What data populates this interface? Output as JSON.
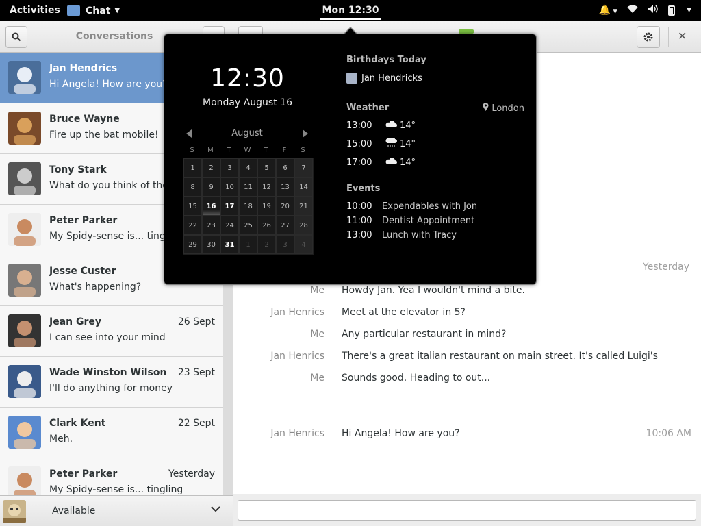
{
  "topbar": {
    "activities": "Activities",
    "app_name": "Chat",
    "clock": "Mon 12:30"
  },
  "sidebar": {
    "title": "Conversations",
    "conversations": [
      {
        "name": "Jan Hendrics",
        "message": "Hi Angela! How are you?",
        "date": "",
        "selected": true
      },
      {
        "name": "Bruce Wayne",
        "message": "Fire up the bat mobile!",
        "date": ""
      },
      {
        "name": "Tony Stark",
        "message": "What do you think of these",
        "date": ""
      },
      {
        "name": "Peter Parker",
        "message": "My Spidy-sense is... tingling",
        "date": ""
      },
      {
        "name": "Jesse Custer",
        "message": "What's happening?",
        "date": ""
      },
      {
        "name": "Jean Grey",
        "message": "I can see into your mind",
        "date": "26 Sept"
      },
      {
        "name": "Wade Winston Wilson",
        "message": "I'll do anything for money",
        "date": "23 Sept"
      },
      {
        "name": "Clark Kent",
        "message": "Meh.",
        "date": "22 Sept"
      },
      {
        "name": "Peter Parker",
        "message": "My Spidy-sense is... tingling",
        "date": "Yesterday"
      }
    ],
    "status": "Available"
  },
  "chat": {
    "day_label": "Yesterday",
    "messages": [
      {
        "who": "Me",
        "text": "Howdy Jan. Yea I wouldn't mind a bite."
      },
      {
        "who": "Jan Henrics",
        "text": "Meet at the elevator in 5?"
      },
      {
        "who": "Me",
        "text": "Any particular restaurant in mind?"
      },
      {
        "who": "Jan Henrics",
        "text": "There's a great italian restaurant on main street. It's called Luigi's"
      },
      {
        "who": "Me",
        "text": "Sounds good. Heading to out..."
      }
    ],
    "latest": {
      "who": "Jan Henrics",
      "text": "Hi Angela! How are you?",
      "time": "10:06 AM"
    },
    "entry_placeholder": ""
  },
  "calendar_popup": {
    "time": "12:30",
    "date": "Monday August 16",
    "month": "August",
    "weekdays": [
      "S",
      "M",
      "T",
      "W",
      "T",
      "F",
      "S"
    ],
    "days": [
      "1",
      "2",
      "3",
      "4",
      "5",
      "6",
      "7",
      "8",
      "9",
      "10",
      "11",
      "12",
      "13",
      "14",
      "15",
      "16",
      "17",
      "18",
      "19",
      "20",
      "21",
      "22",
      "23",
      "24",
      "25",
      "26",
      "27",
      "28",
      "29",
      "30",
      "31",
      "1",
      "2",
      "3",
      "4"
    ],
    "today": "16",
    "birthdays_title": "Birthdays Today",
    "birthday_person": "Jan Hendricks",
    "weather_title": "Weather",
    "weather_location": "London",
    "weather": [
      {
        "time": "13:00",
        "icon": "cloud-icon",
        "temp": "14°"
      },
      {
        "time": "15:00",
        "icon": "rain-icon",
        "temp": "14°"
      },
      {
        "time": "17:00",
        "icon": "cloud-icon",
        "temp": "14°"
      }
    ],
    "events_title": "Events",
    "events": [
      {
        "time": "10:00",
        "title": "Expendables with Jon"
      },
      {
        "time": "11:00",
        "title": "Dentist Appointment"
      },
      {
        "time": "13:00",
        "title": "Lunch with Tracy"
      }
    ]
  }
}
